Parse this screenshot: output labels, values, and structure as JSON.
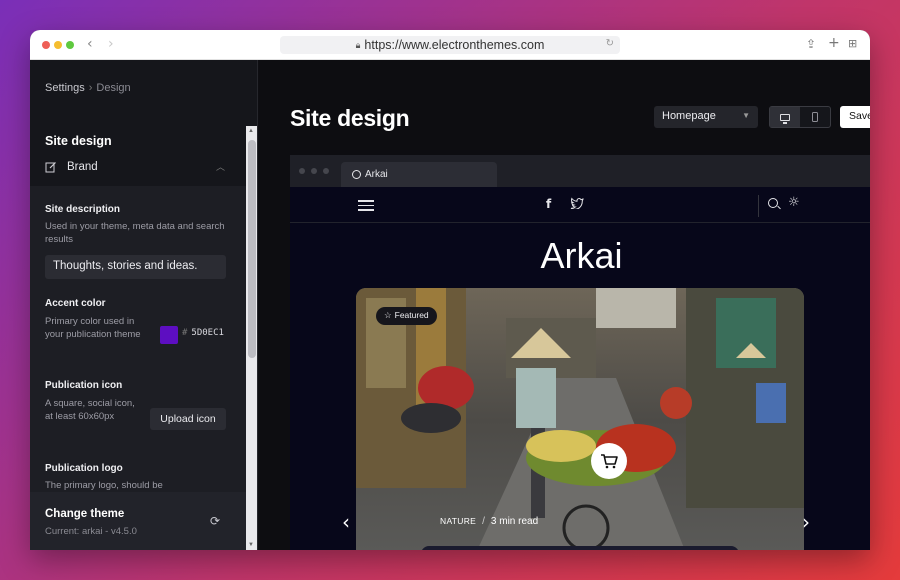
{
  "browser": {
    "url": "https://www.electronthemes.com"
  },
  "sidebar": {
    "breadcrumb": {
      "root": "Settings",
      "current": "Design"
    },
    "title": "Site design",
    "section": "Brand",
    "fields": {
      "site_description": {
        "title": "Site description",
        "desc": "Used in your theme, meta data and search results",
        "value": "Thoughts, stories and ideas."
      },
      "accent_color": {
        "title": "Accent color",
        "desc": "Primary color used in your publication theme",
        "value": "5D0EC1",
        "color": "#5D0EC1"
      },
      "publication_icon": {
        "title": "Publication icon",
        "desc": "A square, social icon, at least 60x60px",
        "button": "Upload icon"
      },
      "publication_logo": {
        "title": "Publication logo",
        "desc": "The primary logo, should be"
      }
    },
    "change_theme": {
      "title": "Change theme",
      "current": "Current: arkai - v4.5.0"
    }
  },
  "main": {
    "title": "Site design",
    "page_select": "Homepage",
    "save_label": "Save"
  },
  "preview": {
    "tab_title": "Arkai",
    "site_title": "Arkai",
    "featured_badge": "Featured",
    "post_tag": "NATURE",
    "read_time": "3 min read"
  }
}
